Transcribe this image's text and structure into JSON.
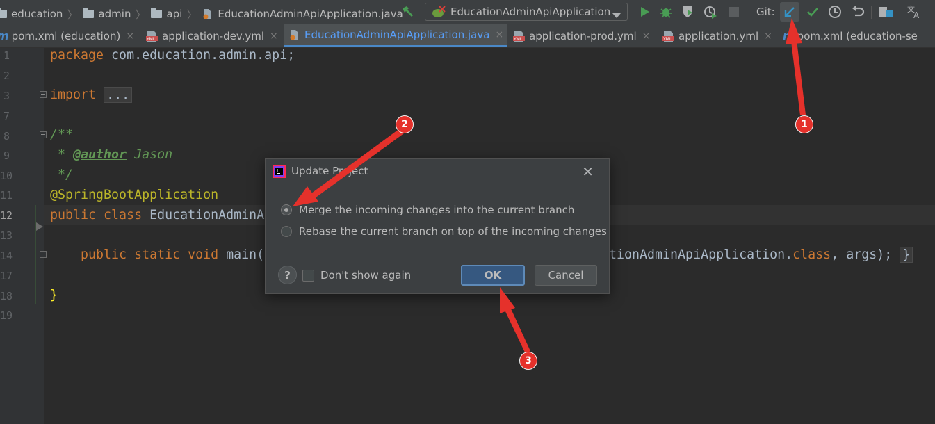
{
  "breadcrumb": {
    "items": [
      "education",
      "admin",
      "api"
    ],
    "file": "EducationAdminApiApplication.java"
  },
  "toolbar": {
    "run_config": "EducationAdminApiApplication",
    "git_label": "Git:"
  },
  "tabs": [
    {
      "label": "pom.xml (education)",
      "icon": "maven-icon",
      "active": false
    },
    {
      "label": "application-dev.yml",
      "icon": "yml-icon",
      "active": false
    },
    {
      "label": "EducationAdminApiApplication.java",
      "icon": "java-file-icon",
      "active": true
    },
    {
      "label": "application-prod.yml",
      "icon": "yml-icon",
      "active": false
    },
    {
      "label": "application.yml",
      "icon": "yml-icon",
      "active": false
    },
    {
      "label": "pom.xml (education-se",
      "icon": "maven-icon",
      "active": false
    }
  ],
  "tab_close": "×",
  "yml_text": "YML",
  "gutter": {
    "line_numbers": [
      "1",
      "2",
      "3",
      "7",
      "8",
      "9",
      "10",
      "11",
      "12",
      "13",
      "14",
      "17",
      "18",
      "19"
    ],
    "current_line": "12"
  },
  "code": {
    "l1_kw": "package",
    "l1_rest": " com.education.admin.api;",
    "l3_kw": "import",
    "l3_folded": "...",
    "l8": "/**",
    "l9_star": " * ",
    "l9_tag": "@author",
    "l9_name": " Jason",
    "l10": " */",
    "l11": "@SpringBootApplication",
    "l12_kw": "public class",
    "l12_name": " EducationAdminA",
    "l14_kw": "    public static void",
    "l14_name": " main(",
    "l14_tail_a": "tionAdminApiApplication.",
    "l14_tail_kw": "class",
    "l14_tail_b": ", args);",
    "l14_brace": "}",
    "l18": "}"
  },
  "dialog": {
    "title": "Update Project",
    "close": "✕",
    "options": [
      {
        "label": "Merge the incoming changes into the current branch",
        "selected": true
      },
      {
        "label": "Rebase the current branch on top of the incoming changes",
        "selected": false
      }
    ],
    "help": "?",
    "checkbox_label": "Don't show again",
    "checkbox_checked": false,
    "ok": "OK",
    "cancel": "Cancel"
  },
  "annotations": [
    "1",
    "2",
    "3"
  ],
  "colors": {
    "accent": "#4a88c7",
    "annotation": "#e5312b",
    "run_green": "#499c54"
  }
}
